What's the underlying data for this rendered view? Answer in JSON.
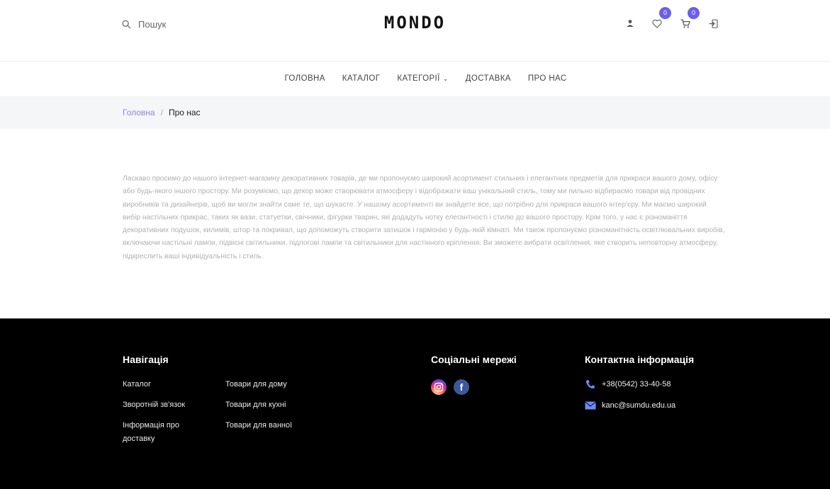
{
  "header": {
    "search_label": "Пошук",
    "logo": "MONDO",
    "wishlist_count": "0",
    "cart_count": "0"
  },
  "nav": {
    "items": [
      {
        "label": "ГОЛОВНА"
      },
      {
        "label": "КАТАЛОГ"
      },
      {
        "label": "КАТЕГОРІЇ"
      },
      {
        "label": "ДОСТАВКА"
      },
      {
        "label": "ПРО НАС"
      }
    ]
  },
  "breadcrumb": {
    "home": "Головна",
    "separator": "/",
    "current": "Про нас"
  },
  "about": {
    "text": "Ласкаво просимо до нашого інтернет-магазину декоративних товарів, де ми пропонуємо широкий асортимент стильних і елегантних предметів для прикраси вашого дому, офісу або будь-якого іншого простору. Ми розуміємо, що декор може створювати атмосферу і відображати ваш унікальний стиль, тому ми пильно відбираємо товари від провідних виробників та дизайнерів, щоб ви могли знайти саме те, що шукаєте. У нашому асортименті ви знайдете все, що потрібно для прикраси вашого інтер'єру. Ми маємо широкий вибір настільних прикрас, таких як вази, статуетки, свічники, фігурки тварин, які додадуть нотку елегантності і стилю до вашого простору. Крім того, у нас є різноманіття декоративних подушок, килимів, штор та покривал, що допоможуть створити затишок і гармонію у будь-якій кімнаті. Ми також пропонуємо різноманітність освітлювальних виробів, включаючи настільні лампи, підвісні світильники, підлогові лампи та світильники для настінного кріплення. Ви зможете вибрати освітлення, яке створить неповторну атмосферу, підкреслить ваші індивідуальність і стиль."
  },
  "footer": {
    "navigation": {
      "title": "Навігація",
      "links": [
        {
          "label": "Каталог"
        },
        {
          "label": "Товари для дому"
        },
        {
          "label": "Зворотній зв'язок"
        },
        {
          "label": "Товари для кухні"
        },
        {
          "label": "Інформація про доставку"
        },
        {
          "label": "Товари для ванної"
        }
      ]
    },
    "social": {
      "title": "Соціальні мережі",
      "icons": [
        "instagram-icon",
        "facebook-icon"
      ]
    },
    "contact": {
      "title": "Контактна інформація",
      "phone": "+38(0542) 33-40-58",
      "email": "kanc@sumdu.edu.ua"
    }
  },
  "colors": {
    "accent": "#6b5ee8",
    "breadcrumb_link": "#8c85e0",
    "footer_bg": "#000000",
    "contact_icon": "#6b8cff"
  }
}
